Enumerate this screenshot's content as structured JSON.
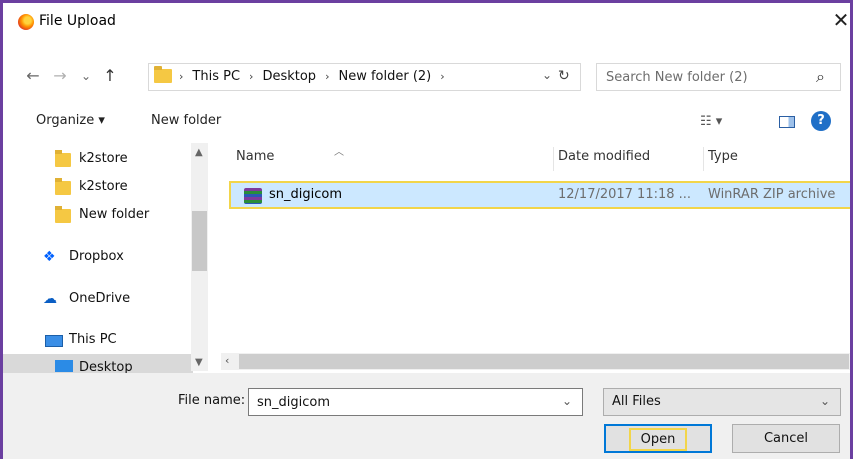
{
  "window": {
    "title": "File Upload",
    "close_glyph": "✕"
  },
  "nav": {
    "back": "←",
    "forward": "→",
    "recent": "⌄",
    "up": "↑"
  },
  "address": {
    "crumbs": [
      "This PC",
      "Desktop",
      "New folder (2)"
    ],
    "separator": "›",
    "dropdown": "⌄",
    "refresh": "↻"
  },
  "search": {
    "placeholder": "Search New folder (2)",
    "icon": "search-icon"
  },
  "toolbar": {
    "organize_label": "Organize ▾",
    "new_folder_label": "New folder",
    "view_label": "☷ ▾",
    "help_label": "?"
  },
  "sidebar": {
    "items": [
      {
        "label": "k2store",
        "icon": "folder-sync-icon"
      },
      {
        "label": "k2store",
        "icon": "folder-icon"
      },
      {
        "label": "New folder",
        "icon": "folder-icon"
      },
      {
        "label": "Dropbox",
        "icon": "dropbox-icon"
      },
      {
        "label": "OneDrive",
        "icon": "onedrive-icon"
      },
      {
        "label": "This PC",
        "icon": "computer-icon"
      },
      {
        "label": "Desktop",
        "icon": "desktop-icon"
      }
    ]
  },
  "file_list": {
    "columns": [
      "Name",
      "Date modified",
      "Type"
    ],
    "rows": [
      {
        "name": "sn_digicom",
        "date": "12/17/2017 11:18 ...",
        "type": "WinRAR ZIP archive",
        "selected": true
      }
    ]
  },
  "bottom": {
    "file_name_label": "File name:",
    "file_name_value": "sn_digicom",
    "filter_value": "All Files",
    "open_label": "Open",
    "cancel_label": "Cancel"
  },
  "colors": {
    "accent": "#0078d7",
    "selection": "#cce8ff",
    "highlight": "#f2d54a",
    "frame": "#6b3fa0"
  }
}
